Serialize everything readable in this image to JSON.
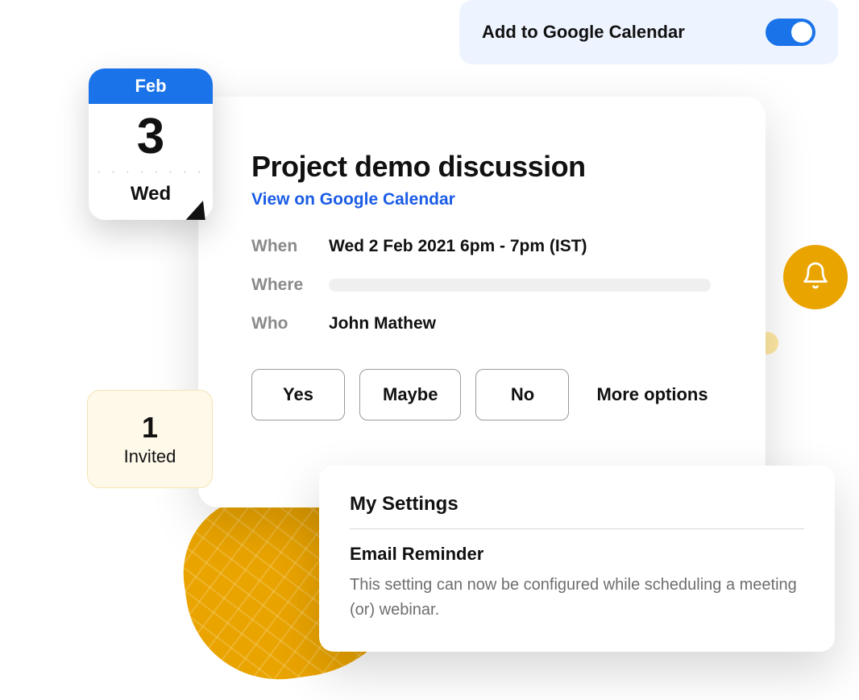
{
  "toggleCard": {
    "label": "Add to Google Calendar",
    "on": true
  },
  "dateBadge": {
    "month": "Feb",
    "day": "3",
    "weekday": "Wed"
  },
  "event": {
    "title": "Project demo discussion",
    "viewLink": "View on Google Calendar",
    "whenLabel": "When",
    "whenValue": "Wed 2 Feb 2021 6pm - 7pm (IST)",
    "whereLabel": "Where",
    "whoLabel": "Who",
    "whoValue": "John Mathew",
    "rsvp": {
      "yes": "Yes",
      "maybe": "Maybe",
      "no": "No",
      "more": "More options"
    }
  },
  "invited": {
    "count": "1",
    "label": "Invited"
  },
  "settings": {
    "title": "My Settings",
    "subtitle": "Email Reminder",
    "description": "This setting can now be configured while scheduling a meeting (or) webinar."
  },
  "icons": {
    "bell": "bell-icon"
  },
  "colors": {
    "accentBlue": "#1a73e8",
    "linkBlue": "#1a5ce6",
    "amber": "#eaa400",
    "paleBlue": "#eef4ff",
    "paleYellow": "#fff9ea"
  }
}
